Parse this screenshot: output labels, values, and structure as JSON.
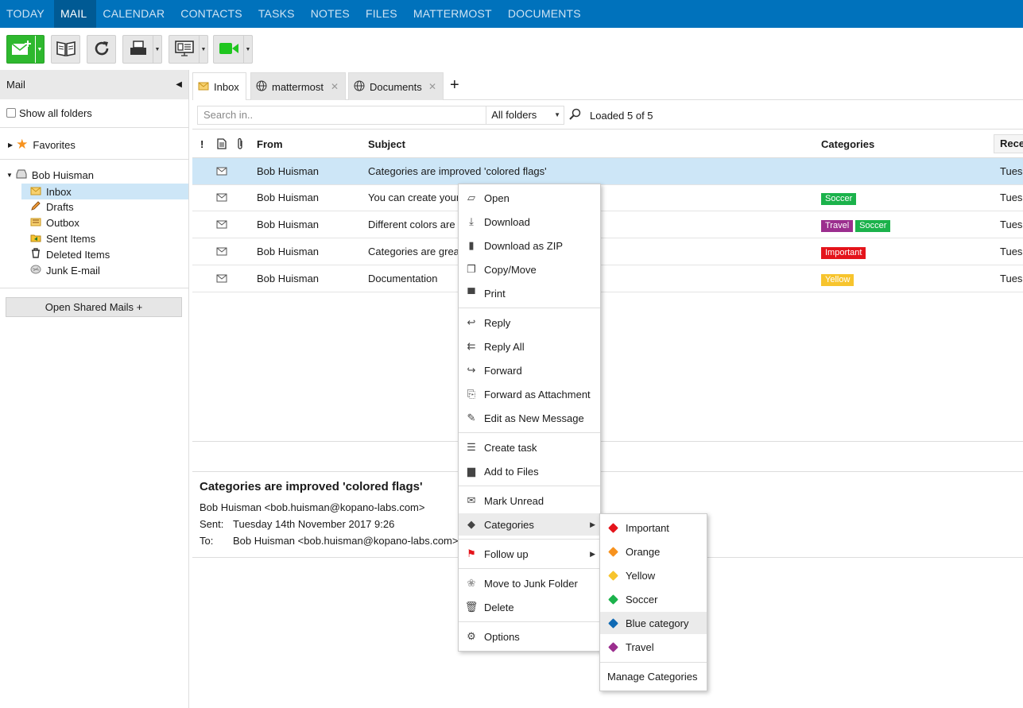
{
  "nav": {
    "tabs": [
      "TODAY",
      "MAIL",
      "CALENDAR",
      "CONTACTS",
      "TASKS",
      "NOTES",
      "FILES",
      "MATTERMOST",
      "DOCUMENTS"
    ],
    "active": "MAIL"
  },
  "sidebar": {
    "title": "Mail",
    "show_all_folders": "Show all folders",
    "favorites": "Favorites",
    "account": "Bob Huisman",
    "folders": [
      "Inbox",
      "Drafts",
      "Outbox",
      "Sent Items",
      "Deleted Items",
      "Junk E-mail"
    ],
    "open_shared": "Open Shared Mails +"
  },
  "content_tabs": [
    "Inbox",
    "mattermost",
    "Documents"
  ],
  "search": {
    "placeholder": "Search in..",
    "scope": "All folders",
    "status": "Loaded 5 of 5"
  },
  "grid": {
    "columns": {
      "flag": "!",
      "from": "From",
      "subject": "Subject",
      "categories": "Categories",
      "received": "Rece"
    },
    "rows": [
      {
        "from": "Bob Huisman",
        "subject": "Categories are improved 'colored flags'",
        "received": "Tues",
        "categories": []
      },
      {
        "from": "Bob Huisman",
        "subject": "You can create your",
        "received": "Tues",
        "categories": [
          "Soccer"
        ]
      },
      {
        "from": "Bob Huisman",
        "subject": "Different colors are",
        "received": "Tues",
        "categories": [
          "Travel",
          "Soccer"
        ]
      },
      {
        "from": "Bob Huisman",
        "subject": "Categories are grea",
        "received": "Tues",
        "categories": [
          "Important"
        ]
      },
      {
        "from": "Bob Huisman",
        "subject": "Documentation",
        "received": "Tues",
        "categories": [
          "Yellow"
        ]
      }
    ]
  },
  "category_colors": {
    "Soccer": "#1bb24b",
    "Travel": "#9b2e8e",
    "Important": "#e4141b",
    "Yellow": "#f7c42d",
    "Orange": "#f7921e",
    "Blue category": "#0f6ab4"
  },
  "preview": {
    "subject": "Categories are improved 'colored flags'",
    "from": "Bob Huisman <bob.huisman@kopano-labs.com>",
    "sent_label": "Sent:",
    "sent": "Tuesday 14th November 2017 9:26",
    "to_label": "To:",
    "to": "Bob Huisman <bob.huisman@kopano-labs.com>"
  },
  "context_menu": {
    "open": "Open",
    "download": "Download",
    "download_zip": "Download as ZIP",
    "copy_move": "Copy/Move",
    "print": "Print",
    "reply": "Reply",
    "reply_all": "Reply All",
    "forward": "Forward",
    "forward_attachment": "Forward as Attachment",
    "edit_new": "Edit as New Message",
    "create_task": "Create task",
    "add_files": "Add to Files",
    "mark_unread": "Mark Unread",
    "categories": "Categories",
    "follow_up": "Follow up",
    "move_junk": "Move to Junk Folder",
    "delete": "Delete",
    "options": "Options"
  },
  "categories_menu": {
    "items": [
      "Important",
      "Orange",
      "Yellow",
      "Soccer",
      "Blue category",
      "Travel"
    ],
    "manage": "Manage Categories"
  }
}
